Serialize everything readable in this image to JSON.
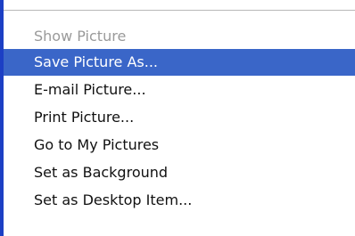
{
  "context_menu": {
    "items": [
      {
        "label": "Show Picture",
        "state": "disabled"
      },
      {
        "label": "Save Picture As...",
        "state": "selected"
      },
      {
        "label": "E-mail Picture...",
        "state": "normal"
      },
      {
        "label": "Print Picture...",
        "state": "normal"
      },
      {
        "label": "Go to My Pictures",
        "state": "normal"
      },
      {
        "label": "Set as Background",
        "state": "normal"
      },
      {
        "label": "Set as Desktop Item...",
        "state": "normal"
      }
    ],
    "colors": {
      "highlight": "#3a66c8",
      "highlight_text": "#ffffff",
      "disabled_text": "#9a9a9a",
      "frame_edge": "#1c3fc4"
    }
  }
}
